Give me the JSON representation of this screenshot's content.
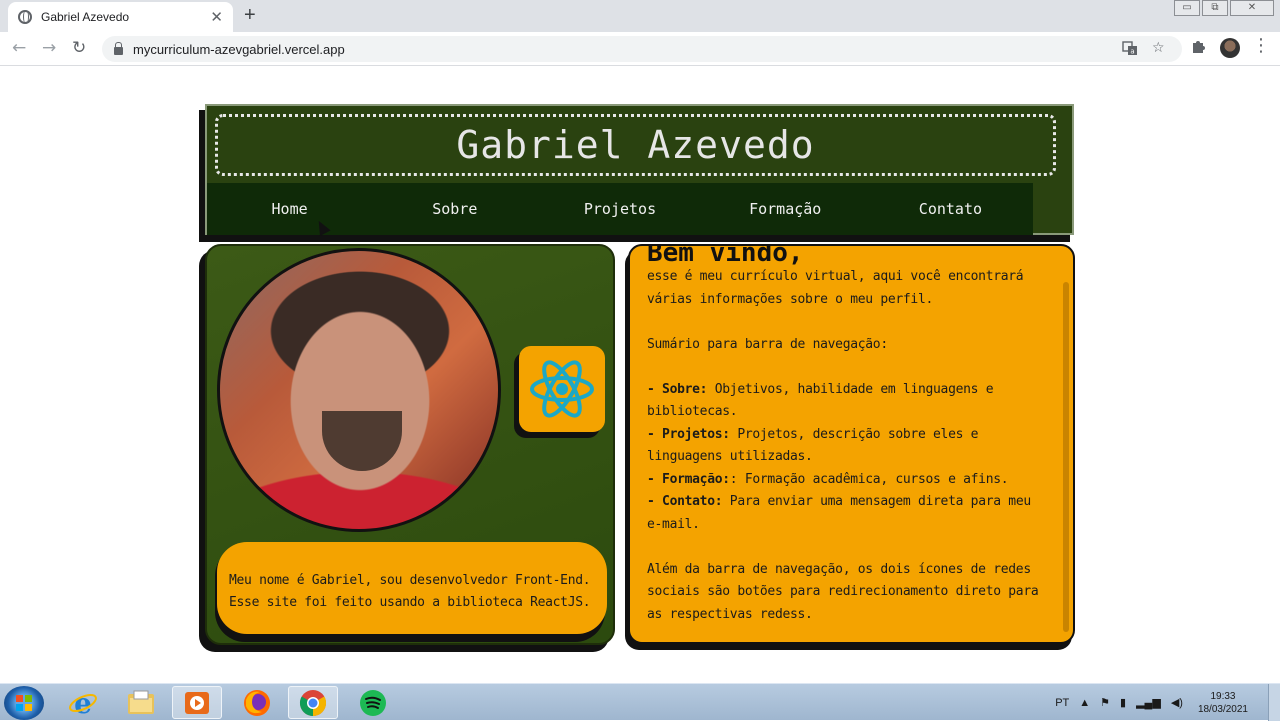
{
  "browser": {
    "tab_title": "Gabriel Azevedo",
    "tab_close": "✕",
    "new_tab": "+",
    "url": "mycurriculum-azevgabriel.vercel.app",
    "window_controls": {
      "minimize": "▭",
      "restore": "⧉",
      "close": "✕"
    },
    "nav": {
      "back": "←",
      "forward": "→",
      "reload": "↻"
    },
    "icons": {
      "translate": "translate-icon",
      "star": "☆",
      "extensions": "puzzle-icon"
    }
  },
  "site": {
    "title": "Gabriel Azevedo",
    "nav": [
      "Home",
      "Sobre",
      "Projetos",
      "Formação",
      "Contato"
    ],
    "bio_lines": [
      "Meu nome é Gabriel, sou desenvolvedor Front-End.",
      "Esse site foi feito usando a biblioteca ReactJS."
    ],
    "welcome_title": "Bem vindo,",
    "intro_lines": [
      "esse é meu currículo virtual, aqui você encontrará",
      "várias informações sobre o meu perfil."
    ],
    "summary_heading": "Sumário para barra de navegação:",
    "summary": [
      {
        "label": "- Sobre:",
        "text": " Objetivos, habilidade em linguagens e"
      },
      {
        "label": "",
        "text": "bibliotecas."
      },
      {
        "label": "- Projetos:",
        "text": " Projetos, descrição sobre eles e"
      },
      {
        "label": "",
        "text": "linguagens utilizadas."
      },
      {
        "label": "- Formação:",
        "text": ": Formação acadêmica, cursos e afins."
      },
      {
        "label": "- Contato:",
        "text": " Para enviar uma mensagem direta para meu"
      },
      {
        "label": "",
        "text": "e-mail."
      }
    ],
    "footer_lines": [
      "Além da barra de navegação, os dois ícones de redes",
      "sociais são botões para redirecionamento direto para",
      "as respectivas redess."
    ],
    "colors": {
      "header_green": "#2a4210",
      "nav_green": "#0f2a08",
      "accent_orange": "#f4a300"
    }
  },
  "taskbar": {
    "apps": [
      "internet-explorer-icon",
      "file-explorer-icon",
      "media-player-icon",
      "firefox-icon",
      "chrome-icon",
      "spotify-icon"
    ],
    "language": "PT",
    "time": "19:33",
    "date": "18/03/2021"
  }
}
